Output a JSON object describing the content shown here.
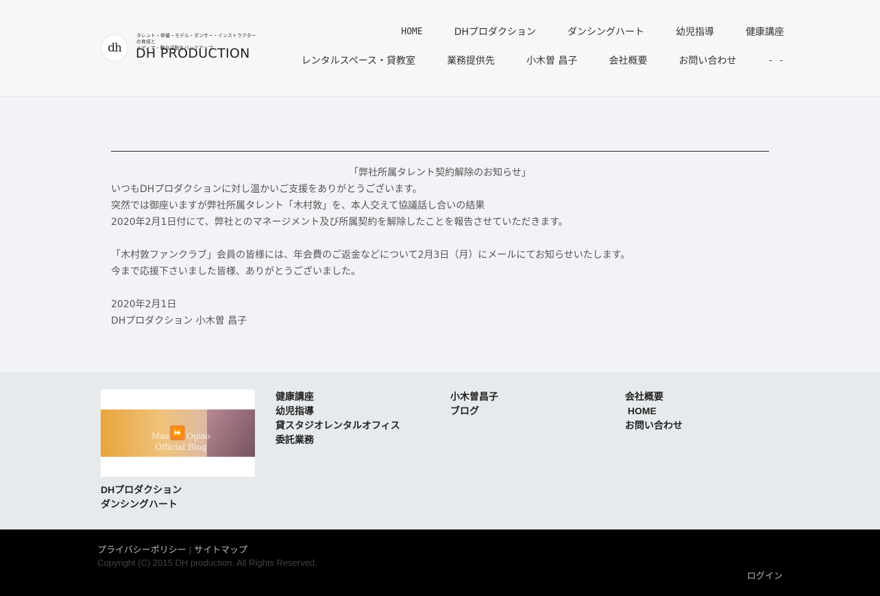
{
  "header": {
    "logo": {
      "mark": "dh",
      "tagline": "タレント・俳優・モデル・ダンサー・インストラクターの育成と\nメディア・舞台活動をバックアップ",
      "name": "DH PRODUCTION"
    },
    "nav_row1": [
      "HOME",
      "DHプロダクション",
      "ダンシングハート",
      "幼児指導",
      "健康講座"
    ],
    "nav_row2": [
      "レンタルスペース・貸教室",
      "業務提供先",
      "小木曽 昌子",
      "会社概要",
      "お問い合わせ",
      "- -"
    ]
  },
  "main": {
    "notice_title": "「弊社所属タレント契約解除のお知らせ」",
    "lines": [
      "いつもDHプロダクションに対し温かいご支援をありがとうございます。",
      "突然では御座いますが弊社所属タレント「木村敦」を、本人交えて協議話し合いの結果",
      "2020年2月1日付にて、弊社とのマネージメント及び所属契約を解除したことを報告させていただきます。",
      "",
      "「木村敦ファンクラブ」会員の皆様には、年会費のご返金などについて2月3日（月）にメールにてお知らせいたします。",
      "今まで応援下さいました皆様、ありがとうございました。",
      "",
      "2020年2月1日",
      "DHプロダクション 小木曽 昌子"
    ]
  },
  "footer": {
    "banner": {
      "text": "Masako Ogiso\nOfficial Blog",
      "icon": "fast-forward-icon",
      "play_glyph": "⏩"
    },
    "col_under_banner": [
      "DHプロダクション",
      "ダンシングハート"
    ],
    "col2": [
      "健康講座",
      "幼児指導",
      "貸スタジオレンタルオフィス",
      "委託業務"
    ],
    "col3": [
      "小木曽昌子",
      "ブログ"
    ],
    "col4": [
      "会社概要",
      " HOME",
      "お問い合わせ"
    ]
  },
  "bottom": {
    "privacy": "プライバシーポリシー",
    "separator": "|",
    "sitemap": "サイトマップ",
    "copyright": "Copyright (C) 2015 DH production. All Rights Reserved.",
    "login": "ログイン"
  }
}
